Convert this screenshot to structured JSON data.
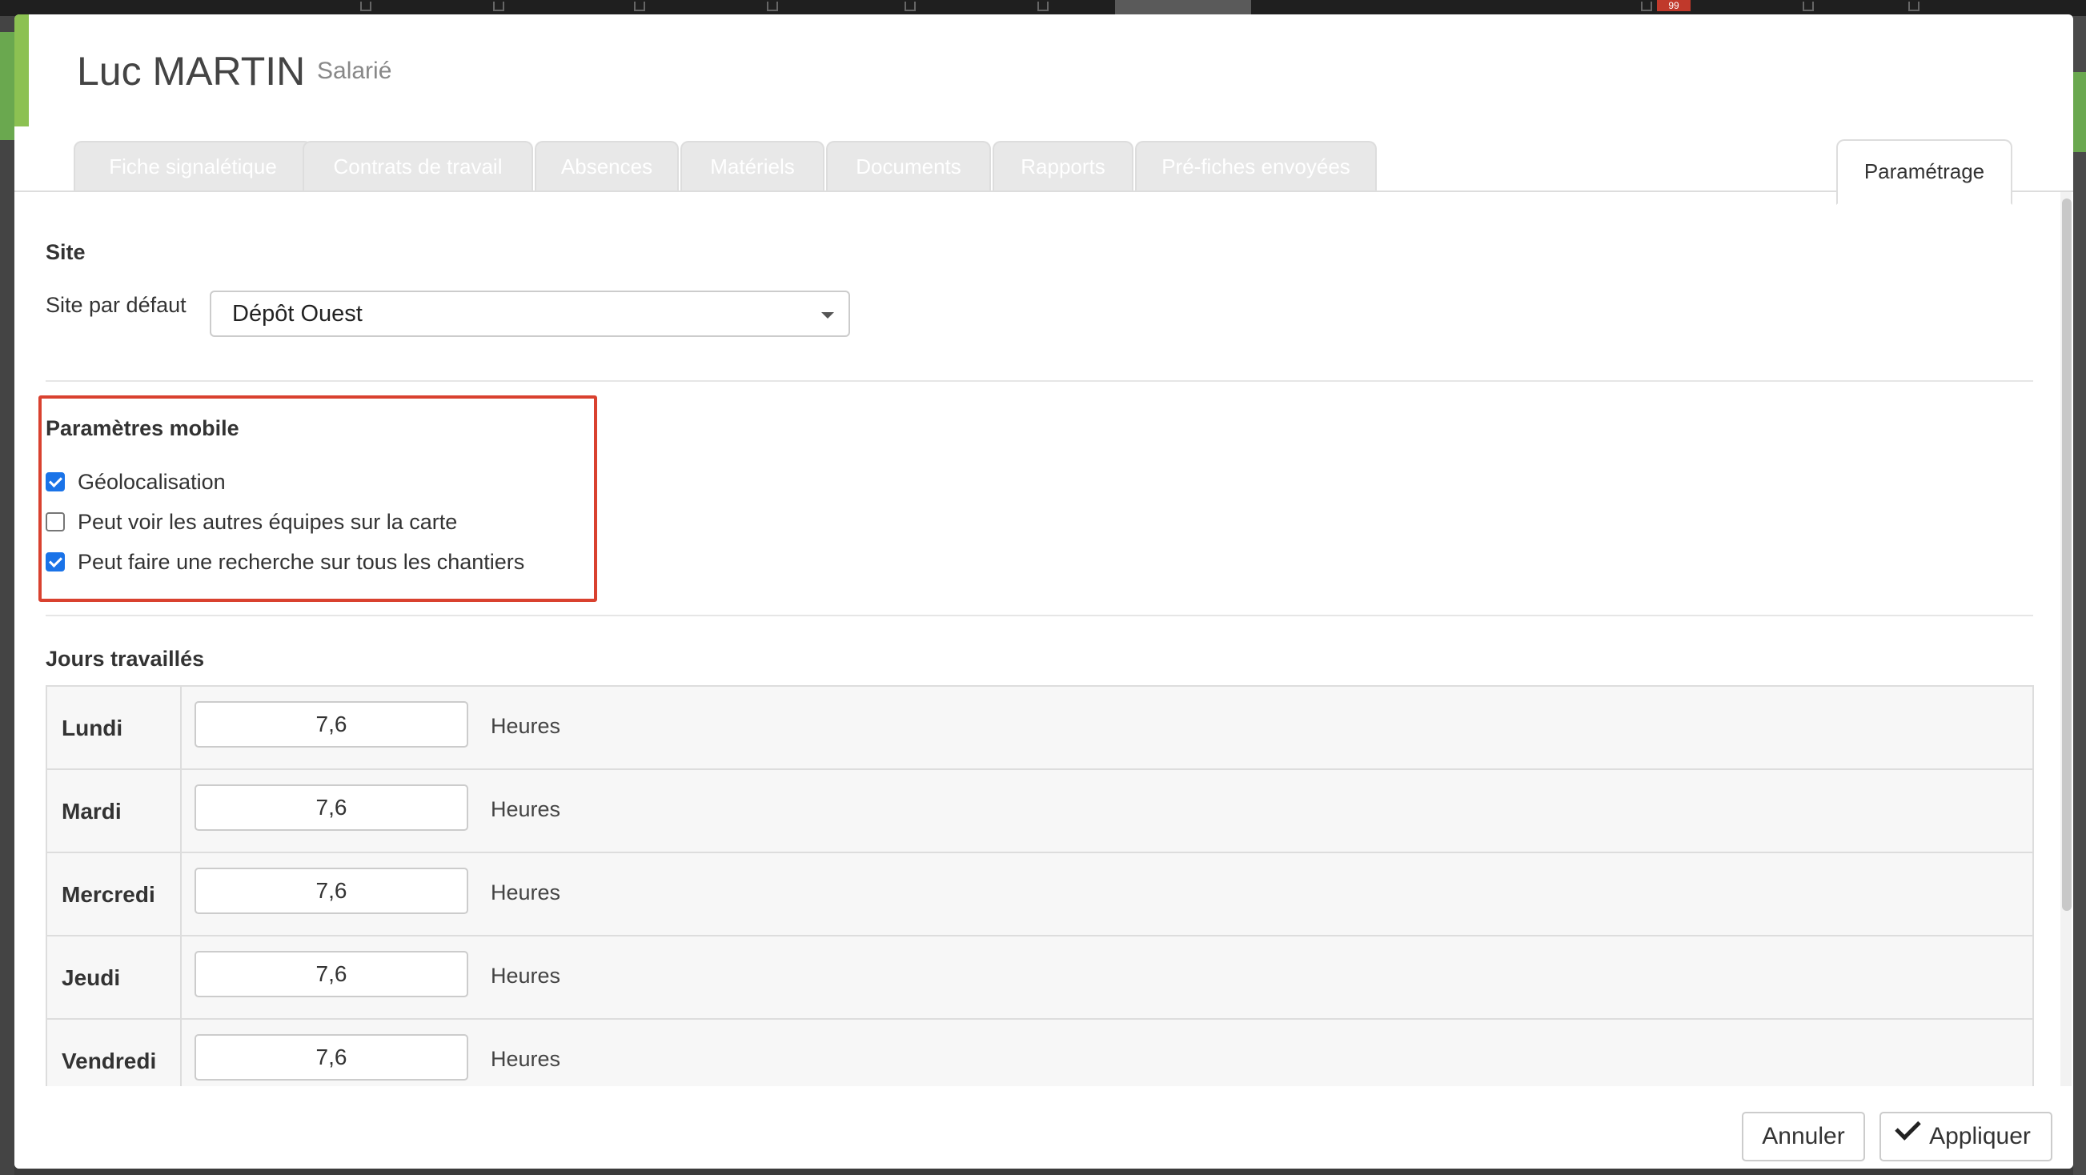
{
  "background": {
    "notification_count": "99"
  },
  "header": {
    "title": "Luc MARTIN",
    "subtitle": "Salarié"
  },
  "tabs": [
    {
      "label": "Fiche signalétique",
      "active": false
    },
    {
      "label": "Contrats de travail",
      "active": false
    },
    {
      "label": "Absences",
      "active": false
    },
    {
      "label": "Matériels",
      "active": false
    },
    {
      "label": "Documents",
      "active": false
    },
    {
      "label": "Rapports",
      "active": false
    },
    {
      "label": "Pré-fiches envoyées",
      "active": false
    },
    {
      "label": "Paramétrage",
      "active": true
    }
  ],
  "site": {
    "title": "Site",
    "default_label": "Site par défaut",
    "default_value": "Dépôt Ouest"
  },
  "mobile": {
    "title": "Paramètres mobile",
    "options": [
      {
        "label": "Géolocalisation",
        "checked": true
      },
      {
        "label": "Peut voir les autres équipes sur la carte",
        "checked": false
      },
      {
        "label": "Peut faire une recherche sur tous les chantiers",
        "checked": true
      }
    ]
  },
  "work_days": {
    "title": "Jours travaillés",
    "unit": "Heures",
    "rows": [
      {
        "day": "Lundi",
        "hours": "7,6"
      },
      {
        "day": "Mardi",
        "hours": "7,6"
      },
      {
        "day": "Mercredi",
        "hours": "7,6"
      },
      {
        "day": "Jeudi",
        "hours": "7,6"
      },
      {
        "day": "Vendredi",
        "hours": "7,6"
      }
    ]
  },
  "footer": {
    "cancel_label": "Annuler",
    "apply_label": "Appliquer"
  },
  "colors": {
    "accent_green": "#8cc152",
    "checkbox_blue": "#1a73e8",
    "highlight_red": "#d9412f"
  }
}
